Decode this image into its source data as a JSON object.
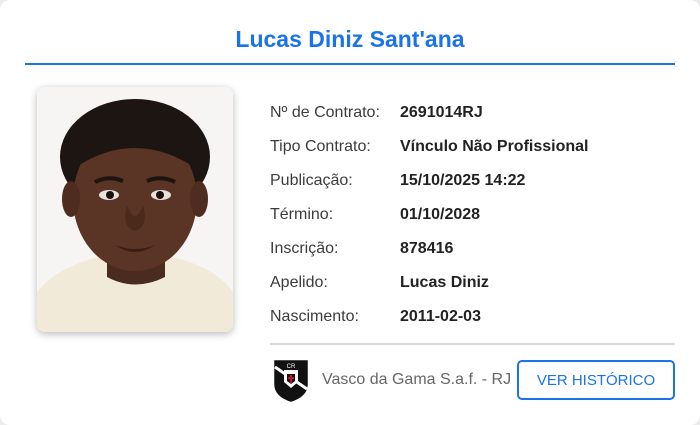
{
  "player": {
    "name": "Lucas Diniz Sant'ana"
  },
  "fields": [
    {
      "label": "Nº de Contrato:",
      "value": "2691014RJ"
    },
    {
      "label": "Tipo Contrato:",
      "value": "Vínculo Não Profissional"
    },
    {
      "label": "Publicação:",
      "value": "15/10/2025 14:22"
    },
    {
      "label": "Término:",
      "value": "01/10/2028"
    },
    {
      "label": "Inscrição:",
      "value": "878416"
    },
    {
      "label": "Apelido:",
      "value": "Lucas Diniz"
    },
    {
      "label": "Nascimento:",
      "value": "2011-02-03"
    }
  ],
  "club": {
    "name": "Vasco da Gama S.a.f. - RJ",
    "logo_icon": "vasco-crest-icon"
  },
  "actions": {
    "history_label": "VER HISTÓRICO"
  },
  "colors": {
    "accent": "#1a73e8"
  }
}
